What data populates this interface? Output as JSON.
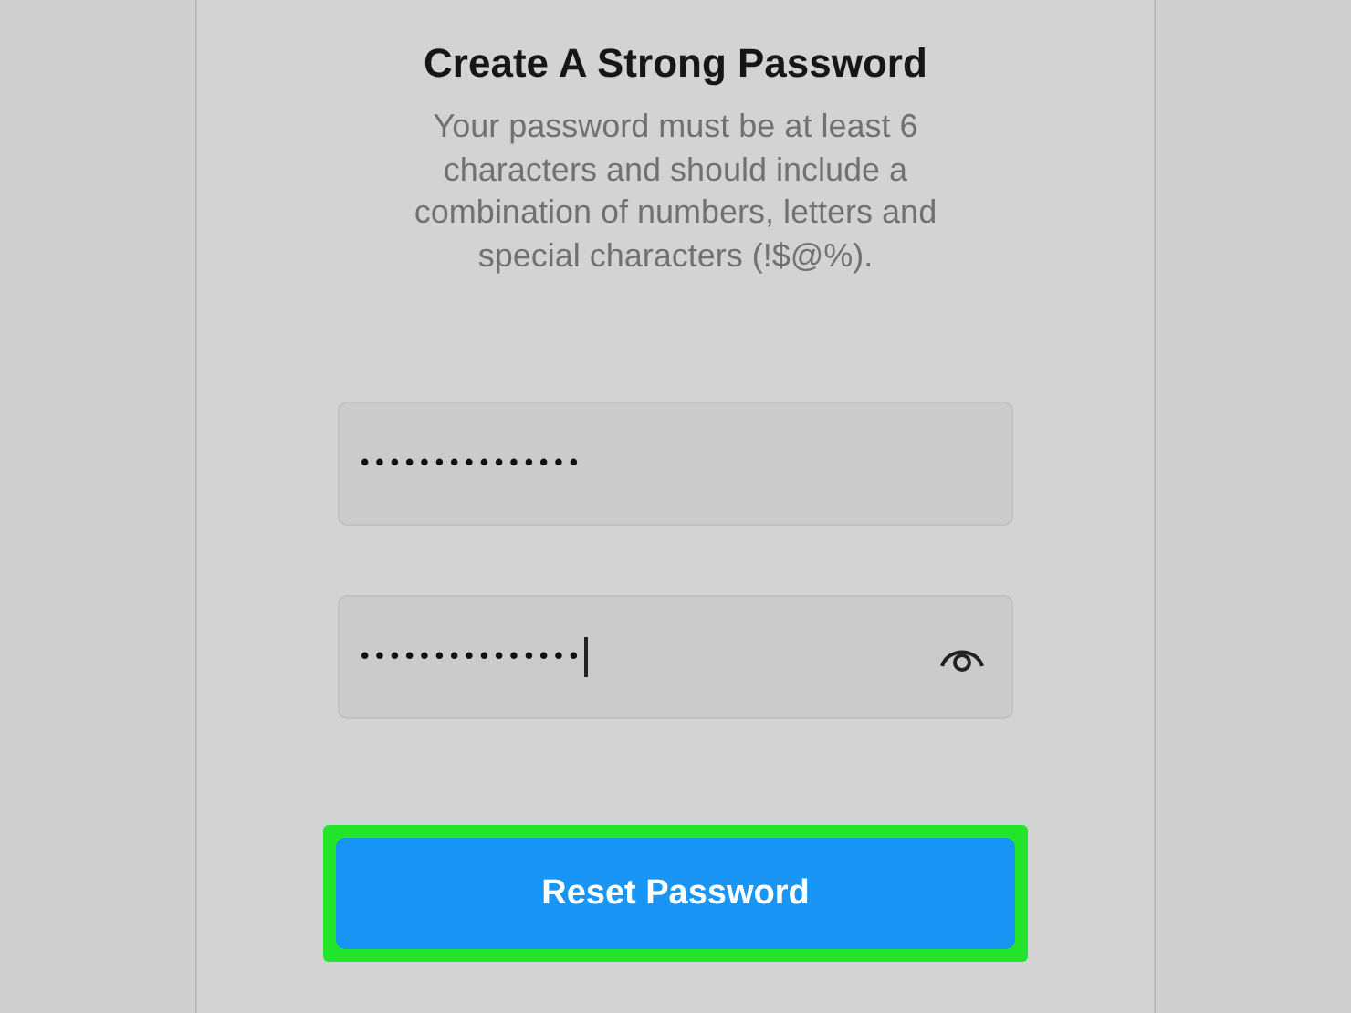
{
  "title": "Create A Strong Password",
  "description": "Your password must be at least 6 characters and should include a combination of numbers, letters and special characters (!$@%).",
  "fields": [
    {
      "value": "•••••••••••••••",
      "focused": false,
      "reveal_toggle": false
    },
    {
      "value": "•••••••••••••••",
      "focused": true,
      "reveal_toggle": true
    }
  ],
  "button": {
    "label": "Reset Password",
    "highlighted": true
  }
}
